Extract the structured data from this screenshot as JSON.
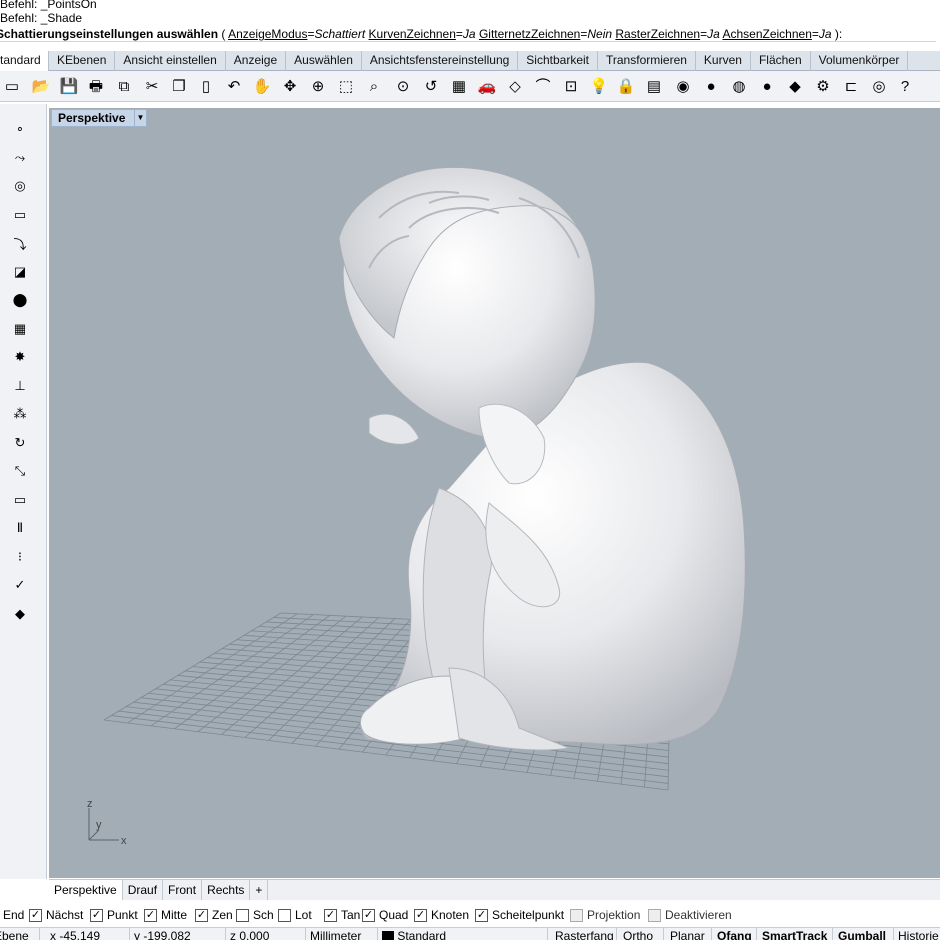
{
  "command_history": {
    "line1": "Befehl: _PointsOn",
    "line2": "Befehl: _Shade"
  },
  "prompt": {
    "title": "Schattierungseinstellungen auswählen",
    "open": "(",
    "opt1_key": "AnzeigeModus",
    "opt1_val": "Schattiert",
    "opt2_key": "KurvenZeichnen",
    "opt2_val": "Ja",
    "opt3_key": "GitternetzZeichnen",
    "opt3_val": "Nein",
    "opt4_key": "RasterZeichnen",
    "opt4_val": "Ja",
    "opt5_key": "AchsenZeichnen",
    "opt5_val": "Ja",
    "close": "):"
  },
  "tabs": [
    "Standard",
    "KEbenen",
    "Ansicht einstellen",
    "Anzeige",
    "Auswählen",
    "Ansichtsfenstereinstellung",
    "Sichtbarkeit",
    "Transformieren",
    "Kurven",
    "Flächen",
    "Volumenkörper"
  ],
  "toolbar_icons": [
    "new-file-icon",
    "open-folder-icon",
    "save-icon",
    "print-icon",
    "import-icon",
    "cut-icon",
    "copy-icon",
    "paste-icon",
    "undo-icon",
    "pan-hand-icon",
    "rotate-view-icon",
    "zoom-icon",
    "zoom-window-icon",
    "zoom-extents-icon",
    "zoom-selected-icon",
    "undo-view-icon",
    "four-viewports-icon",
    "car-icon",
    "named-view-icon",
    "named-cplane-icon",
    "osnap-icon",
    "light-icon",
    "lock-icon",
    "layer-icon",
    "color-wheel-icon",
    "shaded-sphere-icon",
    "rendered-sphere-icon",
    "render-icon",
    "spotlight-icon",
    "options-gear-icon",
    "dimension-icon",
    "plugin-icon",
    "help-icon"
  ],
  "toolbar_glyphs": [
    "▭",
    "📂",
    "💾",
    "🖶",
    "⧉",
    "✂",
    "❐",
    "▯",
    "↶",
    "✋",
    "✥",
    "⊕",
    "⬚",
    "⌕",
    "⊙",
    "↺",
    "▦",
    "🚗",
    "◇",
    "⌒",
    "⊡",
    "💡",
    "🔒",
    "▤",
    "◉",
    "●",
    "◍",
    "●",
    "◆",
    "⚙",
    "⊏",
    "◎",
    "?"
  ],
  "side_icons": [
    "point-icon",
    "curve-icon",
    "circle-icon",
    "rectangle-icon",
    "arc-icon",
    "surface-icon",
    "solid-spheres-icon",
    "mesh-icon",
    "explode-icon",
    "boolean-icon",
    "group-icon",
    "rotate-icon",
    "scale-icon",
    "dimension-side-icon",
    "text-icon",
    "array-icon",
    "check-icon",
    "project-icon"
  ],
  "side_glyphs": [
    "∘",
    "⤳",
    "◎",
    "▭",
    "⤵",
    "◪",
    "⬤",
    "▦",
    "✸",
    "⊥",
    "⁂",
    "↻",
    "⤡",
    "▭",
    "Ⅱ",
    "⁝",
    "✓",
    "◆"
  ],
  "viewport": {
    "title": "Perspektive",
    "arrow": "▼",
    "axis_z": "z",
    "axis_y": "y",
    "axis_x": "x"
  },
  "viewport_tabs": [
    "Perspektive",
    "Drauf",
    "Front",
    "Rechts"
  ],
  "add_tab_icon": "+",
  "osnaps": [
    {
      "label": "End",
      "checked": true,
      "disabled": false
    },
    {
      "label": "Nächst",
      "checked": true,
      "disabled": false
    },
    {
      "label": "Punkt",
      "checked": true,
      "disabled": false
    },
    {
      "label": "Mitte",
      "checked": true,
      "disabled": false
    },
    {
      "label": "Zen",
      "checked": true,
      "disabled": false
    },
    {
      "label": "Sch",
      "checked": false,
      "disabled": false
    },
    {
      "label": "Lot",
      "checked": false,
      "disabled": false
    },
    {
      "label": "Tan",
      "checked": true,
      "disabled": false
    },
    {
      "label": "Quad",
      "checked": true,
      "disabled": false
    },
    {
      "label": "Knoten",
      "checked": true,
      "disabled": false
    },
    {
      "label": "Scheitelpunkt",
      "checked": true,
      "disabled": false
    },
    {
      "label": "Projektion",
      "checked": false,
      "disabled": true
    },
    {
      "label": "Deaktivieren",
      "checked": false,
      "disabled": true
    }
  ],
  "check_glyph": "✓",
  "status": {
    "cplane": "Ebene",
    "x": "x -45.149",
    "y": "y -199.082",
    "z": "z 0.000",
    "units": "Millimeter",
    "layer": "Standard",
    "layer_color": "#000000",
    "rasterfang": "Rasterfang",
    "ortho": "Ortho",
    "planar": "Planar",
    "ofang": "Ofang",
    "smarttrack": "SmartTrack",
    "gumball": "Gumball",
    "history": "Historie"
  }
}
